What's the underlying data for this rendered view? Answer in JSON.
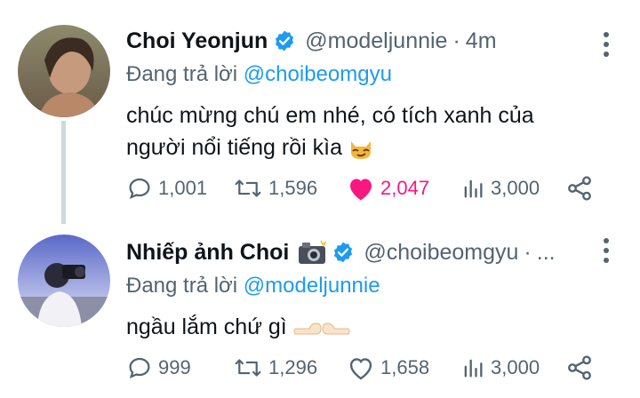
{
  "tweets": [
    {
      "display_name": "Choi Yeonjun",
      "handle": "@modeljunnie",
      "separator": "·",
      "time": "4m",
      "reply_prefix": "Đang trả lời",
      "reply_to": "@choibeomgyu",
      "text_line1": "chúc mừng chú em nhé, có tích xanh của",
      "text_line2": "người nổi tiếng rồi kìa",
      "emoji": "cat-smirk-emoji",
      "replies": "1,001",
      "retweets": "1,596",
      "likes": "2,047",
      "liked": true,
      "views": "3,000"
    },
    {
      "display_name": "Nhiếp ảnh Choi",
      "handle": "@choibeomgyu",
      "separator": "·",
      "ellipsis": "...",
      "reply_prefix": "Đang trả lời",
      "reply_to": "@modeljunnie",
      "text_line1": "ngầu lắm chứ gì",
      "emoji": "pointing-hands-emoji",
      "replies": "999",
      "retweets": "1,296",
      "likes": "1,658",
      "liked": false,
      "views": "3,000"
    }
  ],
  "colors": {
    "accent": "#1d9bf0",
    "secondary_text": "#536471",
    "like_pink": "#f91880",
    "thread_line": "#cfd9de"
  }
}
